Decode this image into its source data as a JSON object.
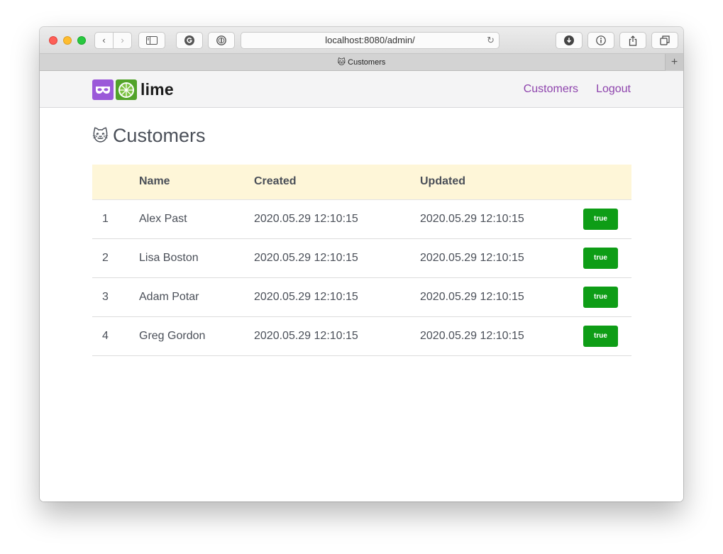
{
  "browser": {
    "url": "localhost:8080/admin/",
    "tab_title": "Customers",
    "tab_emoji": "🐱",
    "back_icon": "‹",
    "forward_icon": "›",
    "new_tab_icon": "+"
  },
  "app": {
    "logo_text": "lime",
    "nav": [
      {
        "label": "Customers"
      },
      {
        "label": "Logout"
      }
    ],
    "accent_color": "#8e44ad"
  },
  "page": {
    "title": "Customers",
    "title_emoji": "🐱"
  },
  "table": {
    "headers": [
      "",
      "Name",
      "Created",
      "Updated",
      ""
    ],
    "rows": [
      {
        "id": "1",
        "name": "Alex Past",
        "created": "2020.05.29 12:10:15",
        "updated": "2020.05.29 12:10:15",
        "status": "true"
      },
      {
        "id": "2",
        "name": "Lisa Boston",
        "created": "2020.05.29 12:10:15",
        "updated": "2020.05.29 12:10:15",
        "status": "true"
      },
      {
        "id": "3",
        "name": "Adam Potar",
        "created": "2020.05.29 12:10:15",
        "updated": "2020.05.29 12:10:15",
        "status": "true"
      },
      {
        "id": "4",
        "name": "Greg Gordon",
        "created": "2020.05.29 12:10:15",
        "updated": "2020.05.29 12:10:15",
        "status": "true"
      }
    ],
    "status_color": "#0e9d16"
  }
}
